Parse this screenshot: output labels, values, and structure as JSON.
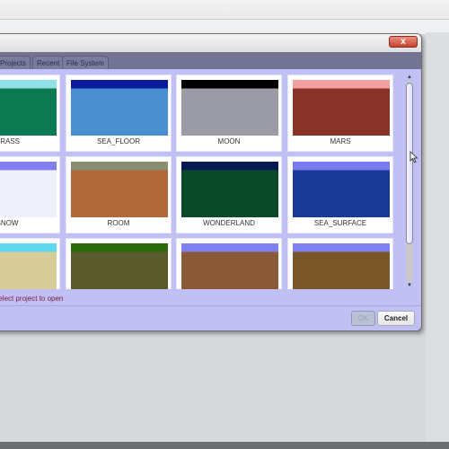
{
  "dialog": {
    "close_label": "x",
    "tabs": [
      {
        "label": "Projects"
      },
      {
        "label": "Recent"
      },
      {
        "label": "File System"
      }
    ],
    "templates": [
      {
        "label": "GRASS",
        "sky": "#8fe0e8",
        "ground": "#0b7a52"
      },
      {
        "label": "SEA_FLOOR",
        "sky": "#0a1a9a",
        "ground": "#4a8fd0"
      },
      {
        "label": "MOON",
        "sky": "#000000",
        "ground": "#9a9ba4"
      },
      {
        "label": "MARS",
        "sky": "#f4a0a0",
        "ground": "#8a3328"
      },
      {
        "label": "SNOW",
        "sky": "#8080f0",
        "ground": "#eef0fa"
      },
      {
        "label": "ROOM",
        "sky": "#8a8e70",
        "ground": "#b0683a"
      },
      {
        "label": "WONDERLAND",
        "sky": "#0a1850",
        "ground": "#0a4a2a"
      },
      {
        "label": "SEA_SURFACE",
        "sky": "#7a7af0",
        "ground": "#1a3a98"
      },
      {
        "label": "",
        "sky": "#60d8f0",
        "ground": "#d8cc98"
      },
      {
        "label": "",
        "sky": "#2a6a0a",
        "ground": "#5a5a2a"
      },
      {
        "label": "",
        "sky": "#8080f0",
        "ground": "#8a5a38"
      },
      {
        "label": "",
        "sky": "#8080f0",
        "ground": "#7a5628"
      }
    ],
    "status": "Select project to open",
    "ok_label": "OK",
    "cancel_label": "Cancel",
    "scroll_up": "▲",
    "scroll_down": "▼"
  }
}
